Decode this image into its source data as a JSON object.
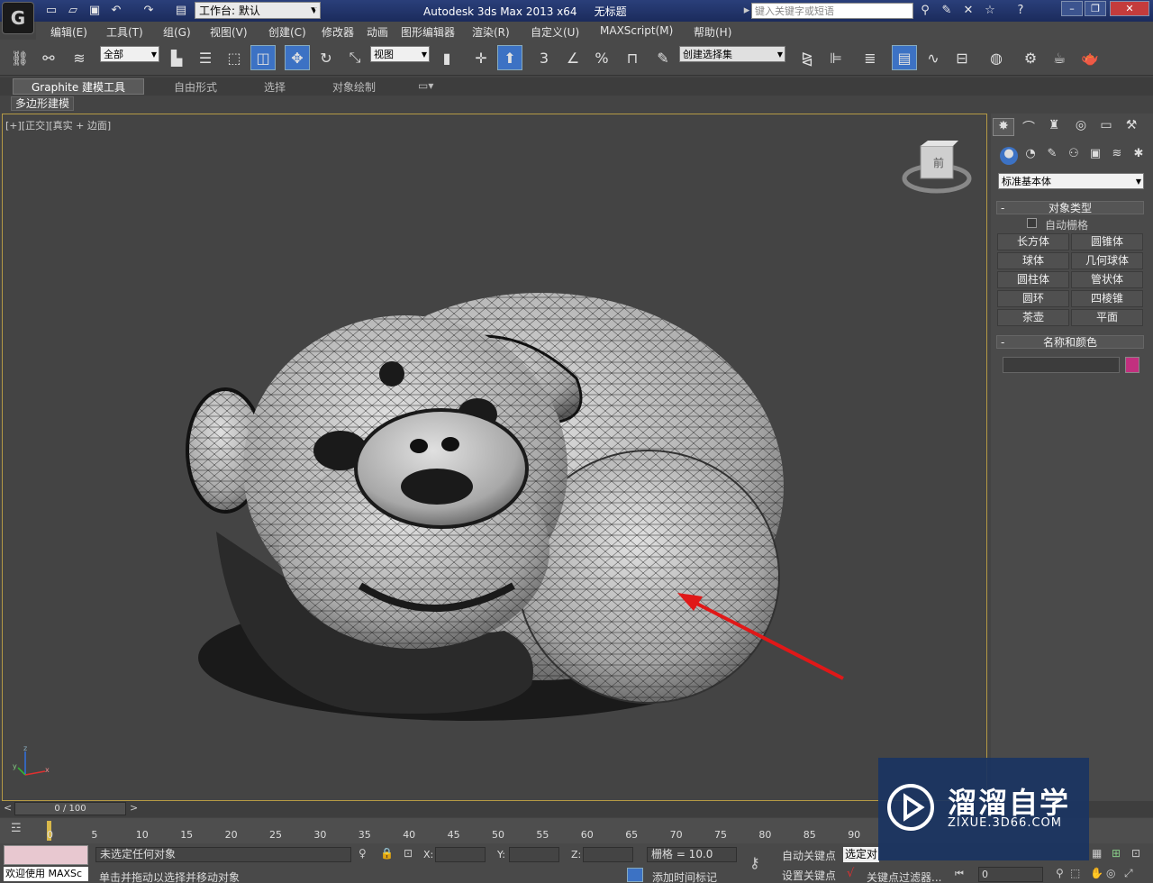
{
  "titlebar": {
    "workspace_label": "工作台: 默认",
    "app_title": "Autodesk 3ds Max  2013 x64",
    "doc_title": "无标题",
    "search_placeholder": "键入关键字或短语"
  },
  "menu": [
    "编辑(E)",
    "工具(T)",
    "组(G)",
    "视图(V)",
    "创建(C)",
    "修改器",
    "动画",
    "图形编辑器",
    "渲染(R)",
    "自定义(U)",
    "MAXScript(M)",
    "帮助(H)"
  ],
  "toolbar": {
    "filter_select": "全部",
    "ref_coord_select": "视图",
    "named_selection": "创建选择集",
    "snap_3": "3",
    "snap_percent": "%"
  },
  "ribbon": {
    "tabs": [
      "Graphite 建模工具",
      "自由形式",
      "选择",
      "对象绘制"
    ],
    "sub_label": "多边形建模"
  },
  "viewport": {
    "label": "[+][正交][真实 + 边面]",
    "viewcube_face": "前",
    "axis_x": "x",
    "axis_y": "y",
    "axis_z": "z"
  },
  "command_panel": {
    "category_select": "标准基本体",
    "object_type_header": "对象类型",
    "autogrid_label": "自动栅格",
    "object_buttons": [
      "长方体",
      "圆锥体",
      "球体",
      "几何球体",
      "圆柱体",
      "管状体",
      "圆环",
      "四棱锥",
      "茶壶",
      "平面"
    ],
    "name_color_header": "名称和颜色",
    "object_color": "#c2307f"
  },
  "timeline": {
    "frame_display": "0 / 100",
    "ticks": [
      "0",
      "5",
      "10",
      "15",
      "20",
      "25",
      "30",
      "35",
      "40",
      "45",
      "50",
      "55",
      "60",
      "65",
      "70",
      "75",
      "80",
      "85",
      "90"
    ]
  },
  "status": {
    "maxscript_label": "欢迎使用 MAXSc",
    "selection_status": "未选定任何对象",
    "prompt": "单击并拖动以选择并移动对象",
    "x_label": "X:",
    "y_label": "Y:",
    "z_label": "Z:",
    "grid_text": "栅格 = 10.0",
    "add_time_tag": "添加时间标记",
    "auto_key": "自动关键点",
    "set_key": "设置关键点",
    "selected_obj": "选定对",
    "key_filters": "关键点过滤器...",
    "frame_value": "0"
  },
  "watermark": {
    "brand": "溜溜自学",
    "url": "ZIXUE.3D66.COM"
  },
  "colors": {
    "accent": "#3c72c4",
    "annotation_arrow": "#e01818",
    "viewport_border": "#b59a45"
  }
}
